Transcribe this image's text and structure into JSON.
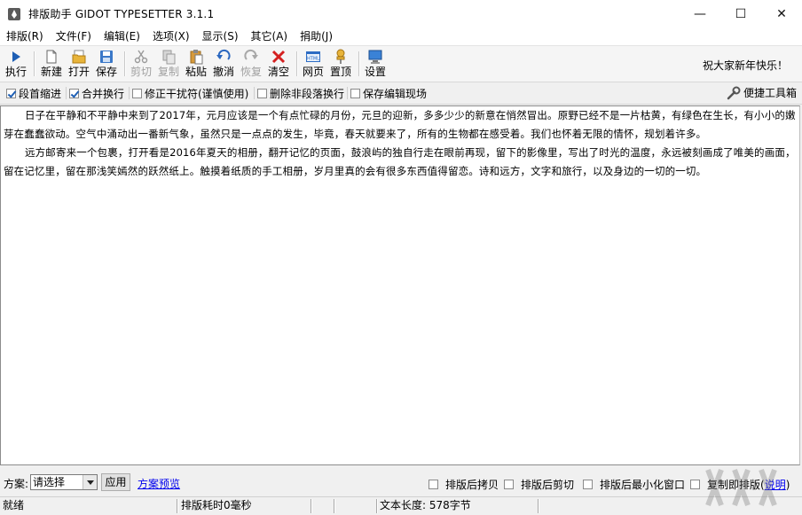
{
  "window": {
    "title": "排版助手 GIDOT TYPESETTER 3.1.1",
    "minimize": "—",
    "maximize": "☐",
    "close": "✕"
  },
  "menu": [
    "排版(R)",
    "文件(F)",
    "编辑(E)",
    "选项(X)",
    "显示(S)",
    "其它(A)",
    "捐助(J)"
  ],
  "toolbar": {
    "run": "执行",
    "new": "新建",
    "open": "打开",
    "save": "保存",
    "cut": "剪切",
    "copy": "复制",
    "paste": "粘贴",
    "undo": "撤消",
    "redo": "恢复",
    "clear": "清空",
    "web": "网页",
    "top": "置顶",
    "settings": "设置",
    "greeting": "祝大家新年快乐！"
  },
  "options": [
    {
      "label": "段首缩进",
      "checked": true
    },
    {
      "label": "合并换行",
      "checked": true
    },
    {
      "label": "修正干扰符(谨慎使用)",
      "checked": false
    },
    {
      "label": "删除非段落换行",
      "checked": false
    },
    {
      "label": "保存编辑现场",
      "checked": false
    }
  ],
  "tools_link": "便捷工具箱",
  "editor": {
    "paragraphs": [
      "日子在平静和不平静中来到了2017年，元月应该是一个有点忙碌的月份，元旦的迎新，多多少少的新意在悄然冒出。原野已经不是一片枯黄，有绿色在生长，有小小的嫩芽在蠢蠢欲动。空气中涌动出一番新气象，虽然只是一点点的发生，毕竟，春天就要来了，所有的生物都在感受着。我们也怀着无限的情怀，规划着许多。",
      "远方邮寄来一个包裹，打开看是2016年夏天的相册，翻开记忆的页面，鼓浪屿的独自行走在眼前再现，留下的影像里，写出了时光的温度，永远被刻画成了唯美的画面，留在记忆里，留在那浅笑嫣然的跃然纸上。触摸着纸质的手工相册，岁月里真的会有很多东西值得留恋。诗和远方，文字和旅行，以及身边的一切的一切。"
    ]
  },
  "bottom": {
    "scheme_label": "方案:",
    "scheme_value": "请选择",
    "apply": "应用",
    "preview": "方案预览",
    "after_copy": "排版后拷贝",
    "after_cut": "排版后剪切",
    "after_min": "排版后最小化窗口",
    "copy_typeset": "复制即排版(",
    "help": "说明",
    "close_paren": ")"
  },
  "status": {
    "ready": "就绪",
    "time": "排版耗时0毫秒",
    "length": "文本长度: 578字节"
  },
  "colors": {
    "accent": "#1e5fb4",
    "link": "#0000ee"
  }
}
